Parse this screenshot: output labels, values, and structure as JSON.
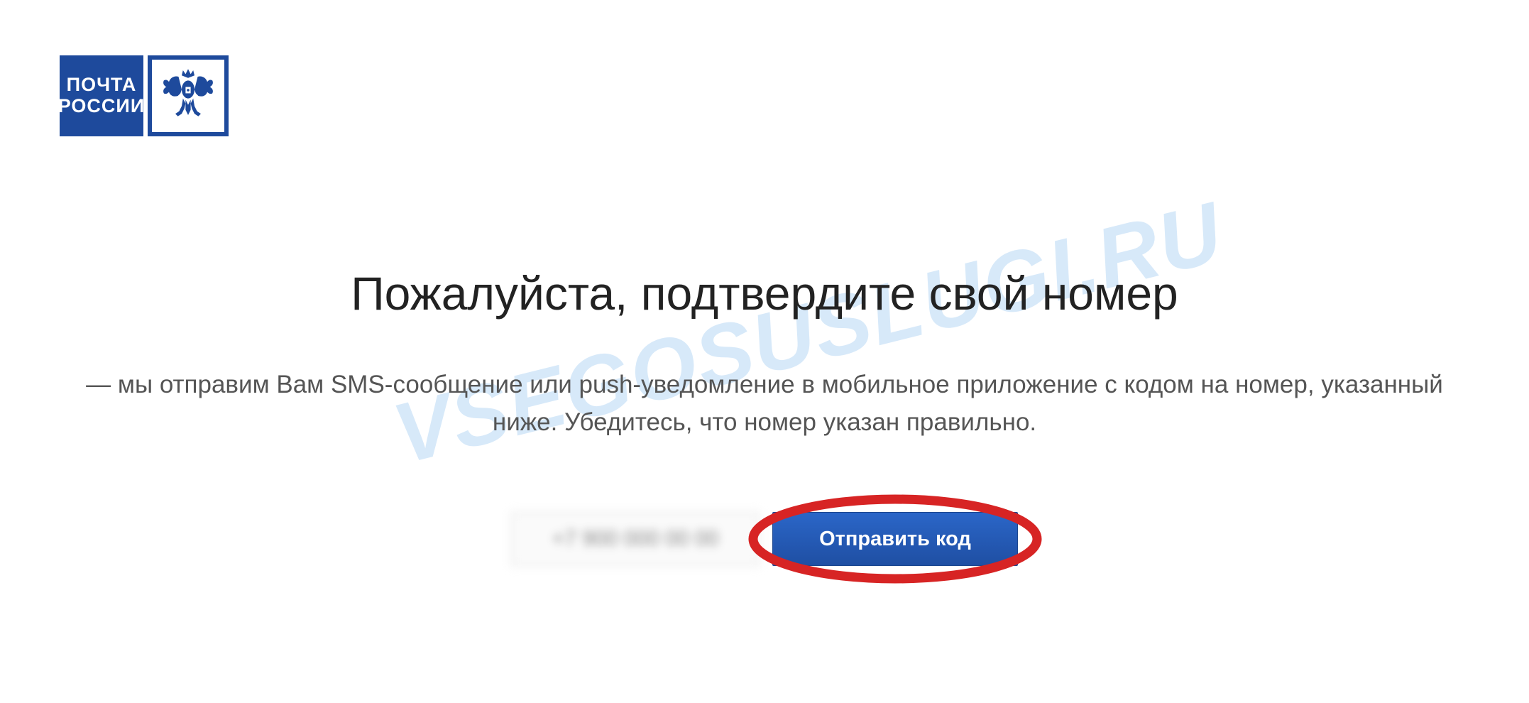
{
  "logo": {
    "line1": "ПОЧТА",
    "line2": "РОССИИ"
  },
  "content": {
    "title": "Пожалуйста, подтвердите свой номер",
    "description": "— мы отправим Вам SMS-сообщение или push-уведомление в мобильное приложение с кодом на номер, указанный ниже. Убедитесь, что номер указан правильно."
  },
  "form": {
    "phone_value": "+7 900 000 00 00",
    "submit_label": "Отправить код"
  },
  "watermark": "VSEGOSUSLUGI.RU"
}
